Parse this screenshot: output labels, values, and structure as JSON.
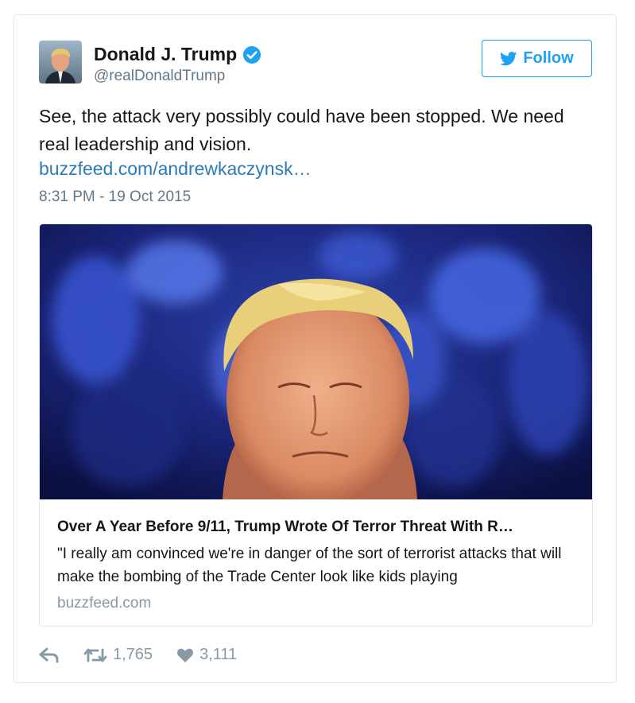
{
  "user": {
    "name": "Donald J. Trump",
    "handle": "@realDonaldTrump"
  },
  "follow_label": "Follow",
  "tweet": {
    "text": "See, the attack very possibly could have been stopped. We need real leadership and vision.",
    "link": "buzzfeed.com/andrewkaczynsk…",
    "timestamp": "8:31 PM - 19 Oct 2015"
  },
  "card": {
    "title": "Over A Year Before 9/11, Trump Wrote Of Terror Threat With R…",
    "description": "\"I really am convinced we're in danger of the sort of terrorist attacks that will make the bombing of the Trade Center look like kids playing",
    "domain": "buzzfeed.com"
  },
  "actions": {
    "retweets": "1,765",
    "likes": "3,111"
  },
  "icons": [
    "verified-badge-icon",
    "twitter-bird-icon",
    "reply-icon",
    "retweet-icon",
    "heart-icon"
  ],
  "colors": {
    "accent": "#1da1f2",
    "link": "#2b7bb9",
    "muted": "#657786",
    "border": "#e1e8ed"
  }
}
